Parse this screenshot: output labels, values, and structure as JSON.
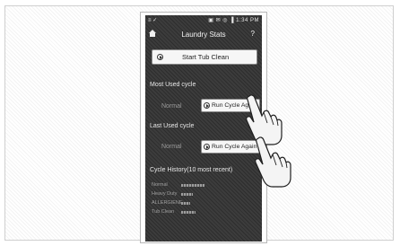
{
  "status_bar": {
    "left_glyphs": "≡ ✓",
    "right_glyphs": "▣ ✉ ◎ ▐",
    "time": "1:34 PM"
  },
  "header": {
    "title": "Laundry Stats",
    "help": "?"
  },
  "tub_clean": {
    "label": "Start Tub Clean"
  },
  "most_used": {
    "heading": "Most Used cycle",
    "cycle_name": "Normal",
    "button_label": "Run Cycle Again"
  },
  "last_used": {
    "heading": "Last Used cycle",
    "cycle_name": "Normal",
    "button_label": "Run Cycle Again"
  },
  "history": {
    "heading": "Cycle History(10 most recent)",
    "rows": [
      {
        "label": "Normal",
        "count": 8
      },
      {
        "label": "Heavy Duty",
        "count": 4
      },
      {
        "label": "ALLERGIENE",
        "count": 3
      },
      {
        "label": "Tub Clean",
        "count": 5
      }
    ]
  },
  "colors": {
    "screen_bg": "#333333",
    "button_bg": "#f6f6f6",
    "text_light": "#e8e8e8",
    "text_dim": "#9a9a9a"
  }
}
